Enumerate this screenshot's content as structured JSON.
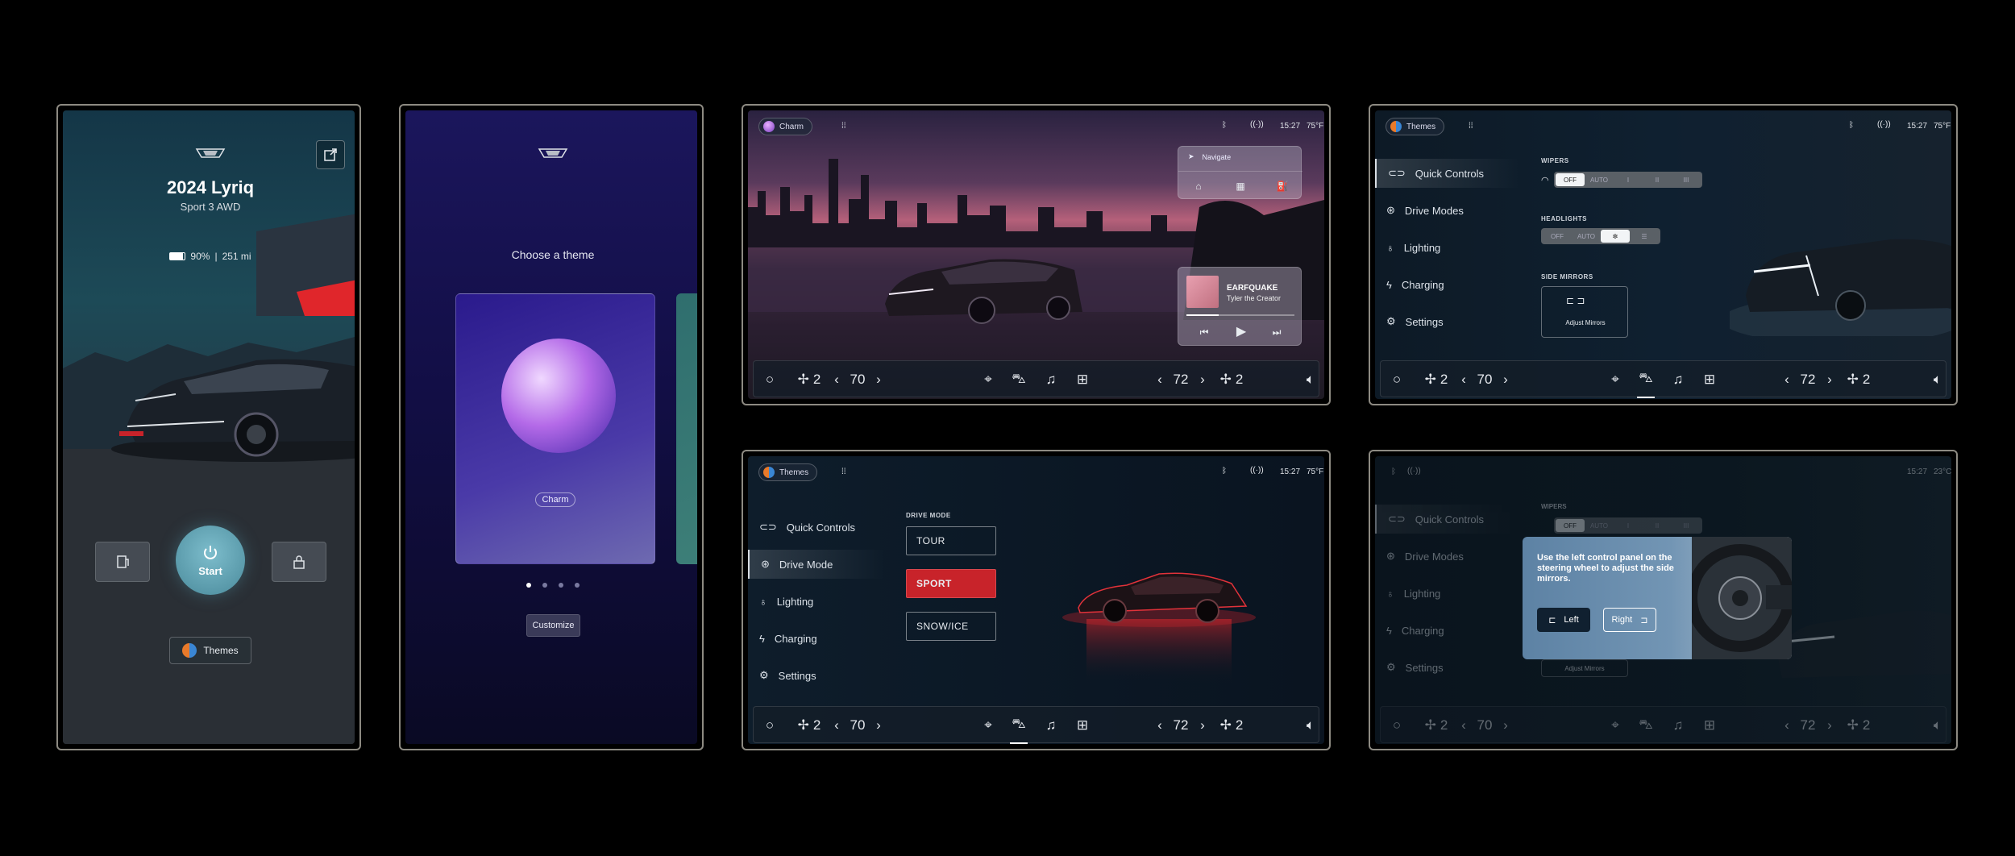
{
  "panel1": {
    "model": "2024 Lyriq",
    "trim": "Sport 3 AWD",
    "battery": "90%",
    "separator": "|",
    "range": "251 mi",
    "start_label": "Start",
    "themes_label": "Themes"
  },
  "panel2": {
    "heading": "Choose a theme",
    "theme_name": "Charm",
    "customize_label": "Customize"
  },
  "panel3": {
    "theme_chip": "Charm",
    "time": "15:27",
    "temp": "75°F",
    "navigate_label": "Navigate",
    "song_title": "EARFQUAKE",
    "song_artist": "Tyler the Creator"
  },
  "panel4": {
    "theme_chip": "Themes",
    "time": "15:27",
    "temp": "75°F",
    "menu": [
      "Quick Controls",
      "Drive Modes",
      "Lighting",
      "Charging",
      "Settings"
    ],
    "wipers_label": "WIPERS",
    "wipers_options": [
      "OFF",
      "AUTO",
      "I",
      "II",
      "III"
    ],
    "headlights_label": "HEADLIGHTS",
    "headlights_options": [
      "OFF",
      "AUTO"
    ],
    "mirrors_label": "SIDE MIRRORS",
    "adjust_mirrors": "Adjust Mirrors"
  },
  "panel5": {
    "theme_chip": "Themes",
    "time": "15:27",
    "temp": "75°F",
    "menu": [
      "Quick Controls",
      "Drive Mode",
      "Lighting",
      "Charging",
      "Settings"
    ],
    "drive_mode_label": "DRIVE MODE",
    "modes": [
      "TOUR",
      "SPORT",
      "SNOW/ICE"
    ]
  },
  "panel6": {
    "time": "15:27",
    "temp": "23°C",
    "menu": [
      "Quick Controls",
      "Drive Modes",
      "Lighting",
      "Charging",
      "Settings"
    ],
    "wipers_label": "WIPERS",
    "wipers_options": [
      "OFF",
      "AUTO",
      "I",
      "II",
      "III"
    ],
    "instruction": "Use the left control panel on the steering wheel to adjust the side mirrors.",
    "left_label": "Left",
    "right_label": "Right",
    "adjust_mirrors": "Adjust Mirrors"
  },
  "climate": {
    "fan_left": "2",
    "temp_left": "70",
    "temp_right": "72",
    "fan_right": "2"
  },
  "colors": {
    "sport_red": "#c8232a",
    "accent": "#e8ecf0"
  },
  "icons": [
    "cadillac-logo-icon",
    "share-icon",
    "battery-icon",
    "power-icon",
    "charge-port-icon",
    "lock-icon",
    "home-icon",
    "building-icon",
    "fuel-icon",
    "navigate-icon",
    "bluetooth-icon",
    "wifi-icon",
    "grid-icon",
    "fan-icon",
    "chevron-left-icon",
    "chevron-right-icon",
    "location-icon",
    "car-icon",
    "music-icon",
    "apps-icon",
    "volume-icon",
    "circle-icon",
    "play-icon",
    "skip-back-icon",
    "skip-forward-icon",
    "wiper-icon",
    "mirror-icon"
  ]
}
